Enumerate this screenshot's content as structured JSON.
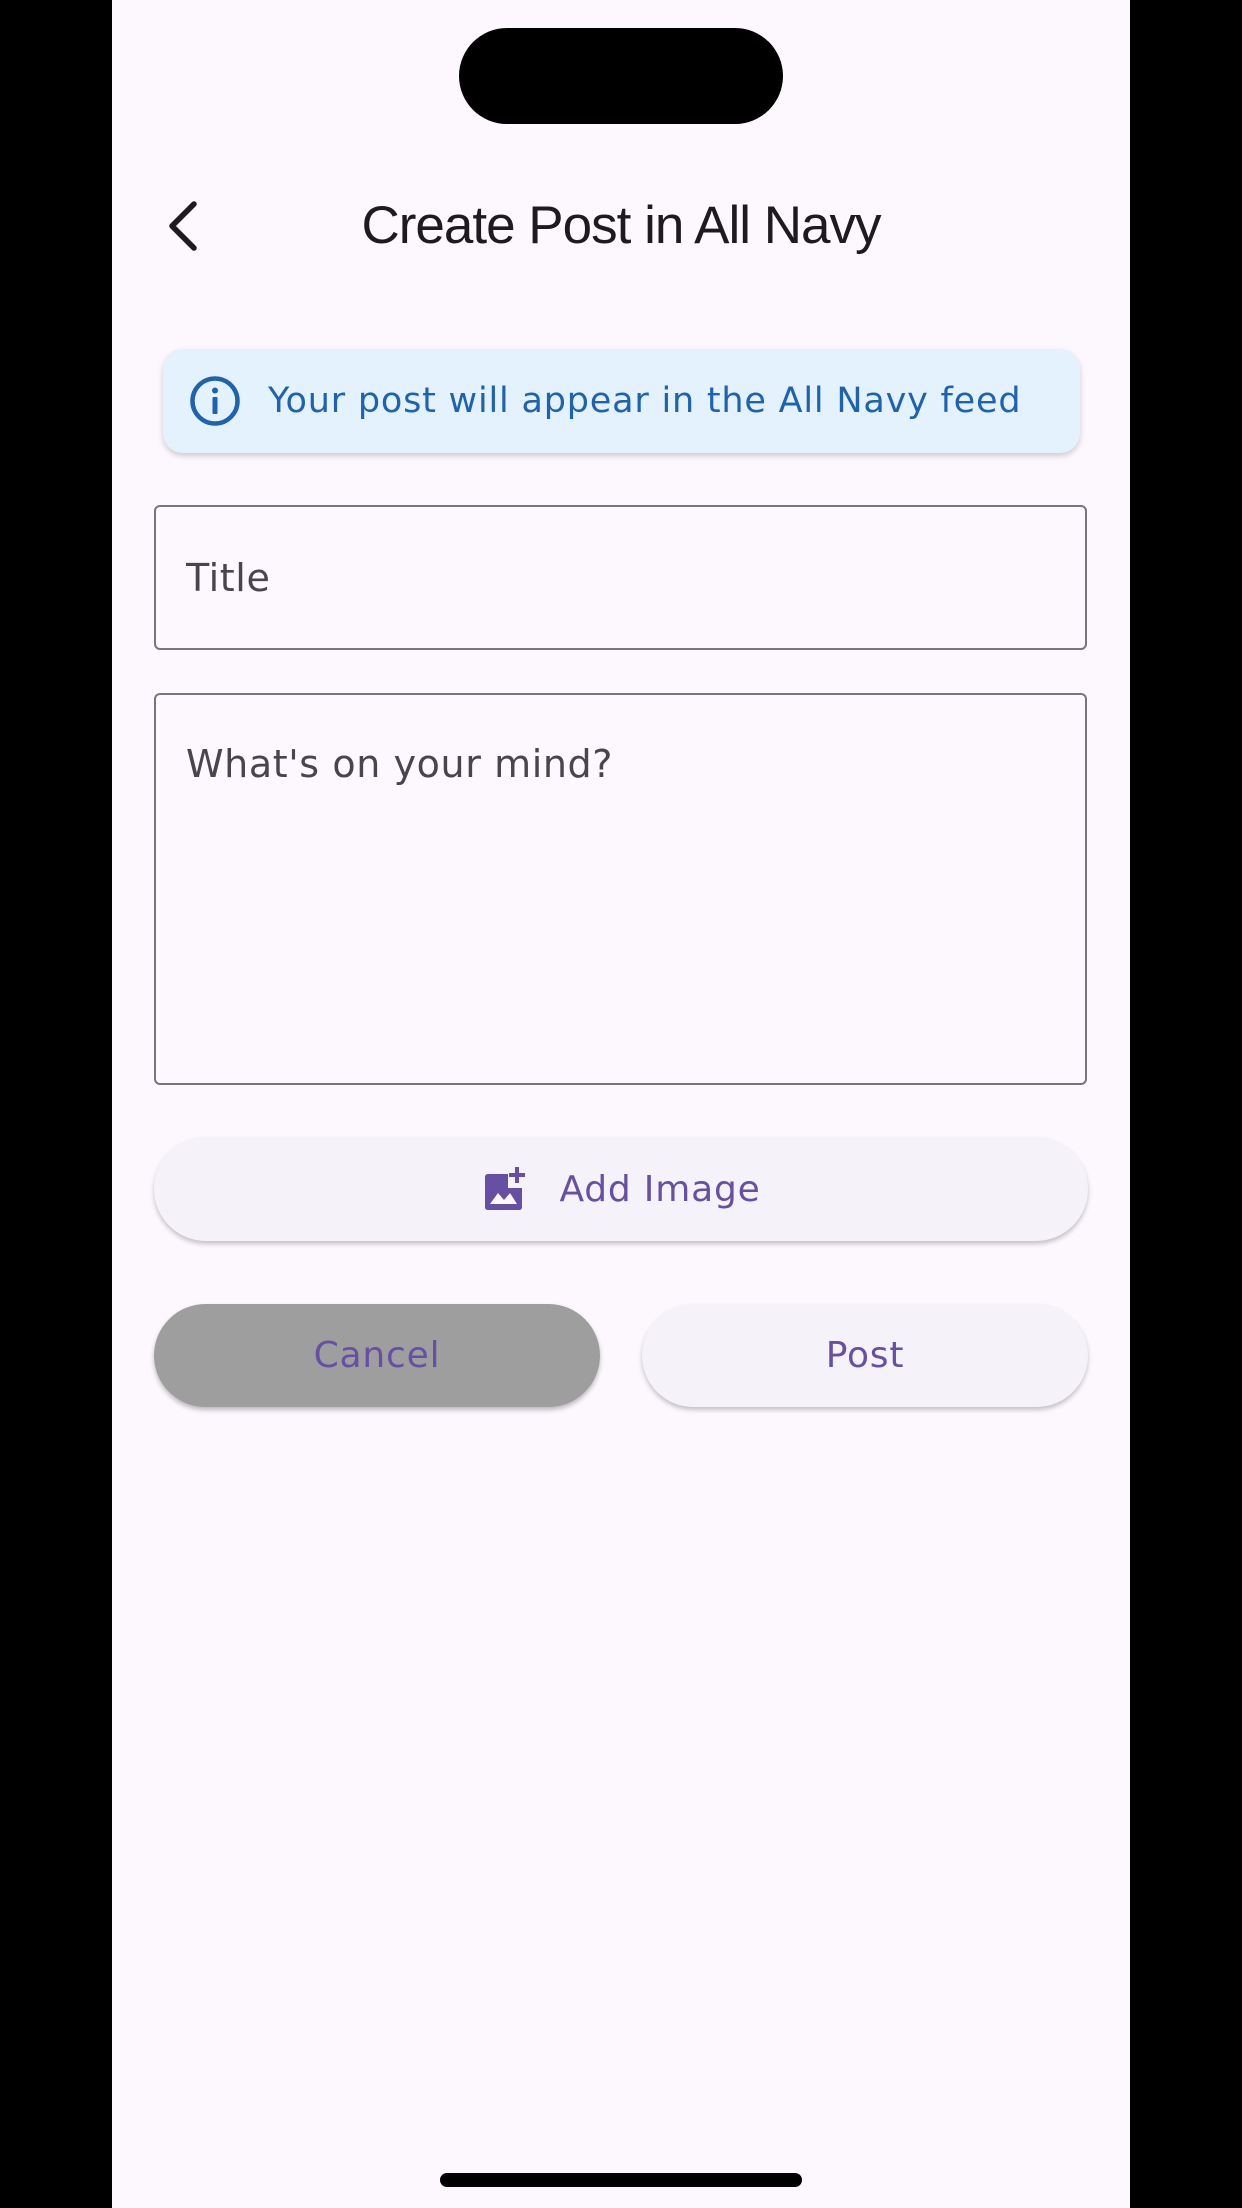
{
  "header": {
    "title": "Create Post in All Navy",
    "back_icon": "chevron-left-icon"
  },
  "info_banner": {
    "icon": "info-icon",
    "text": "Your post will appear in the All Navy feed",
    "background_color": "#e3f2fd",
    "text_color": "#1e63b0"
  },
  "form": {
    "title_field": {
      "placeholder": "Title",
      "value": ""
    },
    "body_field": {
      "placeholder": "What's on your mind?",
      "value": ""
    }
  },
  "add_image": {
    "icon": "add-photo-icon",
    "label": "Add Image"
  },
  "actions": {
    "cancel_label": "Cancel",
    "post_label": "Post"
  },
  "colors": {
    "accent": "#6750a4",
    "background": "#fdf7fe",
    "cancel_background": "#9e9e9e"
  }
}
